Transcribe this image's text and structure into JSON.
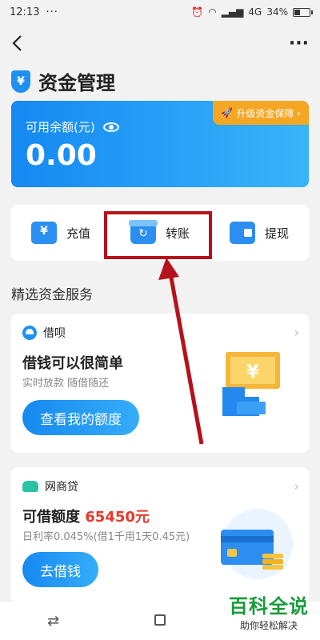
{
  "status_bar": {
    "time": "12:13",
    "dots": "···",
    "network": "4G",
    "battery": "34%",
    "battery_level": 0.34
  },
  "nav": {
    "back_icon": "chevron-left-icon",
    "more_label": "···"
  },
  "page": {
    "title": "资金管理",
    "shield_glyph": "¥"
  },
  "balance": {
    "label": "可用余额(元)",
    "value": "0.00",
    "upgrade_label": "升级资金保障 ›"
  },
  "actions": [
    {
      "label": "充值",
      "icon": "recharge-icon"
    },
    {
      "label": "转账",
      "icon": "transfer-icon"
    },
    {
      "label": "提现",
      "icon": "withdraw-icon"
    }
  ],
  "section_title": "精选资金服务",
  "jiebei": {
    "brand": "借呗",
    "heading": "借钱可以很简单",
    "subtitle": "实时放款 随借随还",
    "cta": "查看我的额度"
  },
  "wangshangdai": {
    "brand": "网商贷",
    "heading_prefix": "可借额度 ",
    "amount": "65450元",
    "subtitle": "日利率0.045%(借1千用1天0.45元)",
    "cta": "去借钱"
  },
  "bottom_nav": {
    "switch_icon": "⇄"
  },
  "watermark": {
    "main": "百科全说",
    "sub": "助你轻松解决"
  },
  "colors": {
    "accent": "#1f8ff0",
    "highlight": "#b5121b",
    "amount": "#e8392b"
  }
}
